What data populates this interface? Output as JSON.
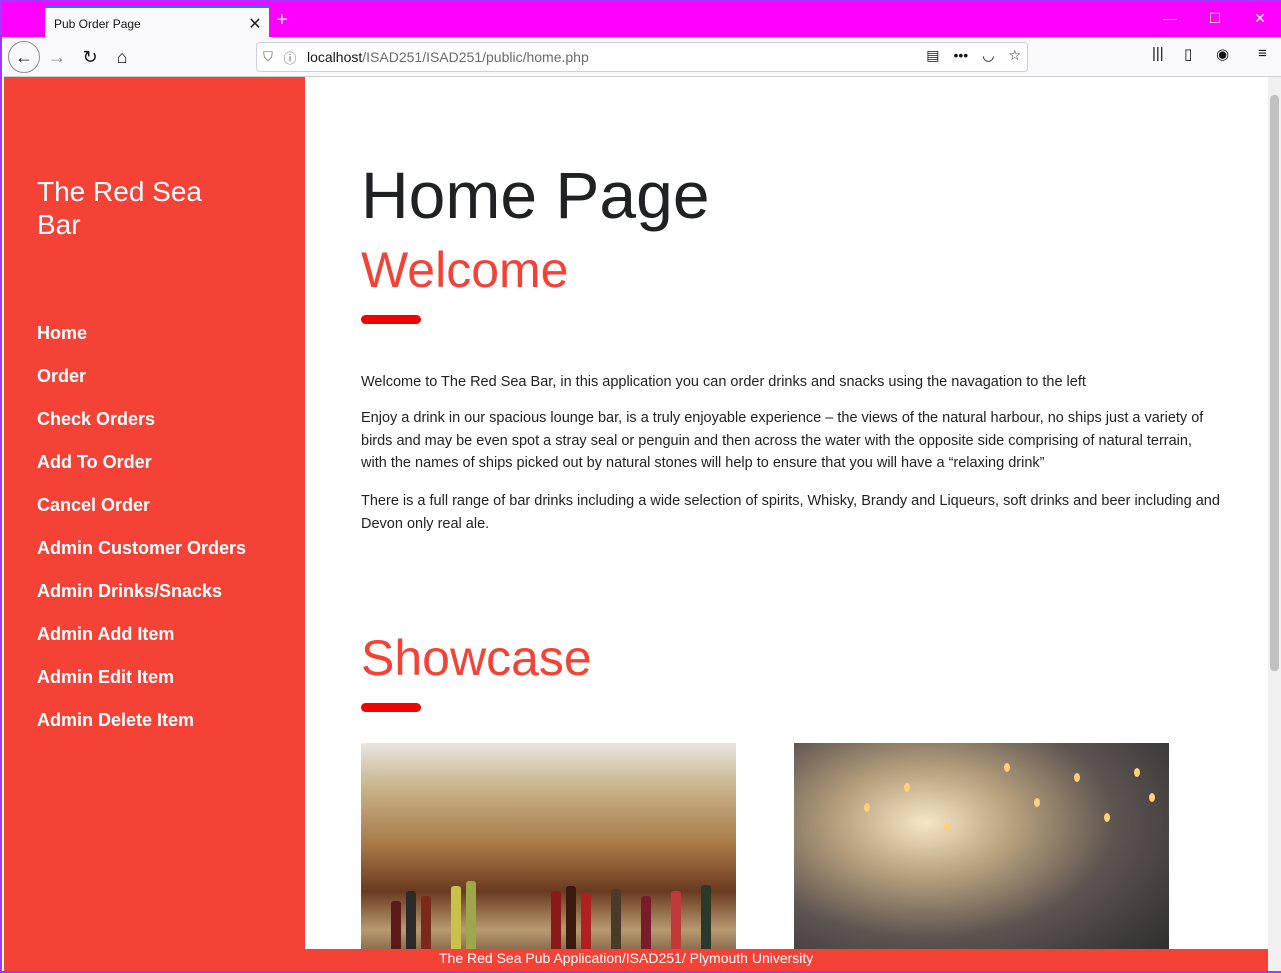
{
  "browser": {
    "tab_title": "Pub Order Page",
    "url_host": "localhost",
    "url_path": "/ISAD251/ISAD251/public/home.php"
  },
  "sidebar": {
    "brand": "The Red Sea Bar",
    "items": [
      {
        "label": "Home"
      },
      {
        "label": "Order"
      },
      {
        "label": "Check Orders"
      },
      {
        "label": "Add To Order"
      },
      {
        "label": "Cancel Order"
      },
      {
        "label": "Admin Customer Orders"
      },
      {
        "label": "Admin Drinks/Snacks"
      },
      {
        "label": "Admin Add Item"
      },
      {
        "label": "Admin Edit Item"
      },
      {
        "label": "Admin Delete Item"
      }
    ]
  },
  "main": {
    "page_title": "Home Page",
    "welcome_heading": "Welcome",
    "paragraphs": [
      "Welcome to The Red Sea Bar, in this application you can order drinks and snacks using the navagation to the left",
      "Enjoy a drink in our spacious lounge bar, is a truly enjoyable experience – the views of the natural harbour, no ships just a variety of birds and may be even spot a stray seal or penguin and then across the water with the opposite side comprising of natural terrain, with the names of ships picked out by natural stones will help to ensure that you will have a “relaxing drink”",
      "There is a full range of bar drinks including a wide selection of spirits, Whisky, Brandy and Liqueurs, soft drinks and beer including and Devon only real ale."
    ],
    "showcase_heading": "Showcase"
  },
  "footer": {
    "text": "The Red Sea Pub Application/ISAD251/ Plymouth University"
  },
  "colors": {
    "accent": "#f44336",
    "underline": "#f30000",
    "titlebar": "#ff00ff"
  }
}
